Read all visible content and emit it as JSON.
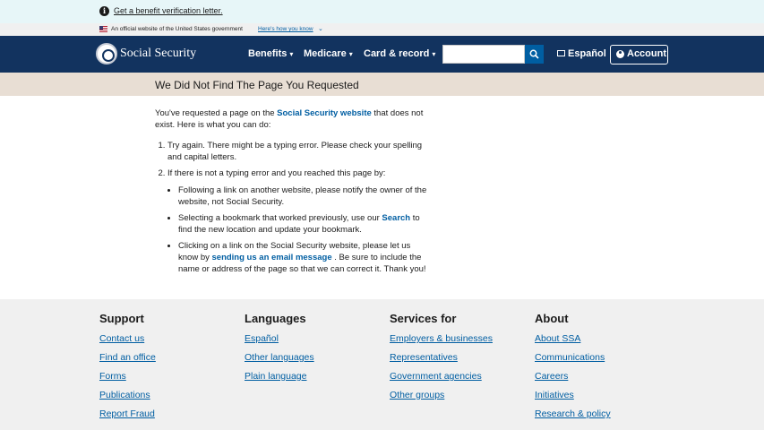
{
  "alert": {
    "icon": "info-icon",
    "link_text": "Get a benefit verification letter."
  },
  "gov_banner": {
    "text": "An official website of the United States government",
    "link_text": "Here's how you know"
  },
  "header": {
    "brand": "Social Security",
    "nav": [
      {
        "label": "Benefits"
      },
      {
        "label": "Medicare"
      },
      {
        "label": "Card & record"
      }
    ],
    "search": {
      "placeholder": "",
      "value": ""
    },
    "espanol_label": "Español",
    "account_label": "Account"
  },
  "page_title": "We Did Not Find The Page You Requested",
  "body": {
    "intro_before": "You've requested a page on the ",
    "intro_link": "Social Security website",
    "intro_after": " that does not exist. Here is what you can do:",
    "step1": "Try again. There might be a typing error. Please check your spelling and capital letters.",
    "step2": "If there is not a typing error and you reached this page by:",
    "sub1": "Following a link on another website, please notify the owner of the website, not Social Security.",
    "sub2_before": "Selecting a bookmark that worked previously, use our ",
    "sub2_link": "Search",
    "sub2_after": " to find the new location and update your bookmark.",
    "sub3_before": "Clicking on a link on the Social Security website, please let us know by ",
    "sub3_link": "sending us an email message",
    "sub3_after": " . Be sure to include the name or address of the page so that we can correct it. Thank you!"
  },
  "footer": {
    "columns": [
      {
        "heading": "Support",
        "links": [
          "Contact us",
          "Find an office",
          "Forms",
          "Publications",
          "Report Fraud"
        ]
      },
      {
        "heading": "Languages",
        "links": [
          "Español",
          "Other languages",
          "Plain language"
        ]
      },
      {
        "heading": "Services for",
        "links": [
          "Employers & businesses",
          "Representatives",
          "Government agencies",
          "Other groups"
        ]
      },
      {
        "heading": "About",
        "links": [
          "About SSA",
          "Communications",
          "Careers",
          "Initiatives",
          "Research & policy"
        ]
      }
    ]
  }
}
